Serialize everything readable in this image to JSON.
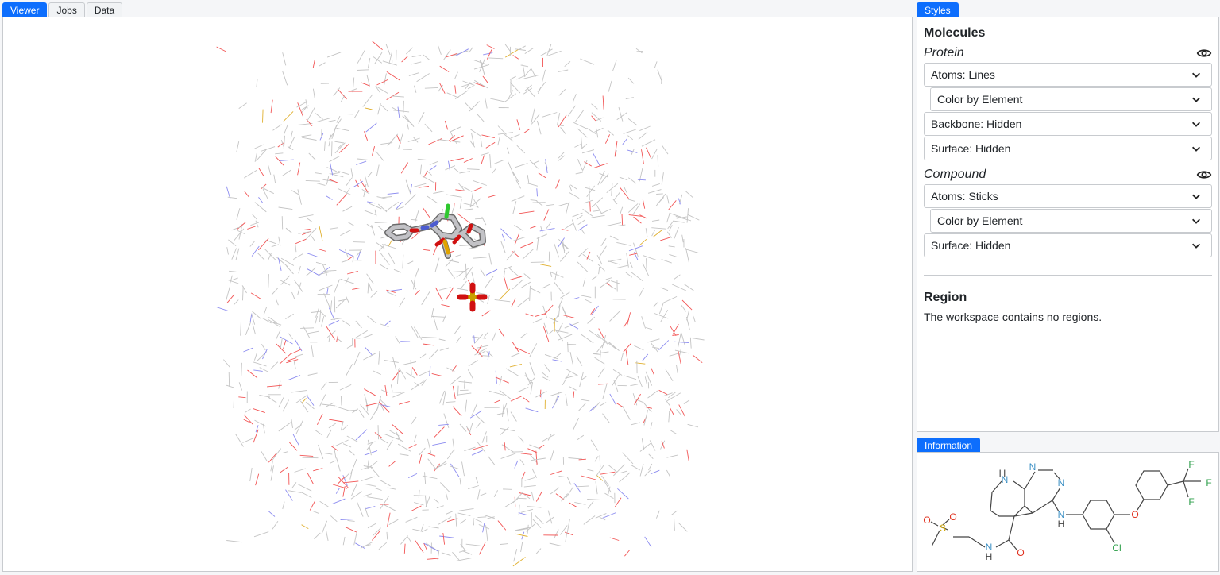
{
  "tabs_left": [
    {
      "label": "Viewer",
      "active": true
    },
    {
      "label": "Jobs",
      "active": false
    },
    {
      "label": "Data",
      "active": false
    }
  ],
  "tabs_styles": {
    "label": "Styles"
  },
  "tabs_info": {
    "label": "Information"
  },
  "styles": {
    "heading": "Molecules",
    "protein": {
      "title": "Protein",
      "atoms": "Atoms: Lines",
      "color": "Color by Element",
      "backbone": "Backbone: Hidden",
      "surface": "Surface: Hidden"
    },
    "compound": {
      "title": "Compound",
      "atoms": "Atoms: Sticks",
      "color": "Color by Element",
      "surface": "Surface: Hidden"
    },
    "region_heading": "Region",
    "region_text": "The workspace contains no regions."
  },
  "structure_labels": {
    "n_ring_h": "H",
    "n_ring": "N",
    "n_pyr1": "N",
    "n_pyr2": "N",
    "nh_amine": "N",
    "nh_amine_h": "H",
    "o_ether": "O",
    "f1": "F",
    "f2": "F",
    "f3": "F",
    "cl": "Cl",
    "o_carbonyl": "O",
    "n_amide": "N",
    "n_amide_h": "H",
    "s": "S",
    "o_s1": "O",
    "o_s2": "O"
  },
  "colors": {
    "accent": "#0d6efd",
    "nitrogen": "#3a8fc4",
    "oxygen": "#e0301e",
    "chlorine": "#2e9f4a",
    "fluorine": "#2e9f4a",
    "sulfur": "#c9a000"
  }
}
